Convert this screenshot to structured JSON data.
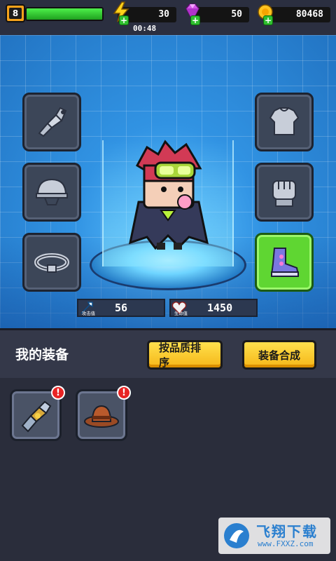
{
  "topbar": {
    "level": "8",
    "hp_fraction": 1.0,
    "energy": "30",
    "gems": "50",
    "coins": "80468",
    "timer": "00:48"
  },
  "slots": {
    "left": [
      "gauntlet-icon",
      "helmet-icon",
      "belt-icon"
    ],
    "right": [
      "armor-icon",
      "glove-icon",
      "boots-icon"
    ],
    "equipped": "boots-icon"
  },
  "stats": {
    "attack_label": "攻击值",
    "attack_value": "56",
    "hp_label": "生命值",
    "hp_value": "1450"
  },
  "panel": {
    "title": "我的装备",
    "sort_button": "按品质排序",
    "merge_button": "装备合成",
    "items": [
      {
        "icon": "gauntlet-icon",
        "alert": "!"
      },
      {
        "icon": "cowboy-hat-icon",
        "alert": "!"
      }
    ]
  },
  "watermark": {
    "brand": "飞翔下载",
    "url": "www.FXXZ.com"
  },
  "colors": {
    "accent": "#f5b718",
    "stage_blue": "#2e8ed9",
    "equipped_green": "#5fd632",
    "hp_green": "#2fbf2f",
    "alert_red": "#e82424"
  }
}
